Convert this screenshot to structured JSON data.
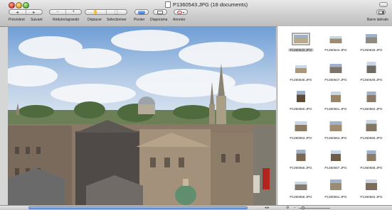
{
  "window": {
    "title": "P1360543.JPG (18 documents)"
  },
  "toolbar": {
    "prev_next": {
      "prev": "Précédent",
      "next": "Suivant"
    },
    "zoom": {
      "label": "Réduire/agrandir",
      "minus": "−",
      "plus": "+"
    },
    "move": {
      "label": "Déplacer"
    },
    "select": {
      "label": "Sélectionner"
    },
    "rotate": {
      "label": "Pivoter"
    },
    "slideshow": {
      "label": "Diaporama"
    },
    "annotate": {
      "label": "Annoter"
    },
    "sidebar": {
      "label": "Barre latérale"
    }
  },
  "thumbnails": [
    {
      "name": "P1360543.JPG",
      "selected": true
    },
    {
      "name": "P1360544.JPG",
      "selected": false
    },
    {
      "name": "P1360545.JPG",
      "selected": false
    },
    {
      "name": "P1360546.JPG",
      "selected": false
    },
    {
      "name": "P1360547.JPG",
      "selected": false
    },
    {
      "name": "P1360549.JPG",
      "selected": false
    },
    {
      "name": "P1360550.JPG",
      "selected": false
    },
    {
      "name": "P1360551.JPG",
      "selected": false
    },
    {
      "name": "P1360552.JPG",
      "selected": false
    },
    {
      "name": "P1360553.JPG",
      "selected": false
    },
    {
      "name": "P1360554.JPG",
      "selected": false
    },
    {
      "name": "P1360555.JPG",
      "selected": false
    },
    {
      "name": "P1360556.JPG",
      "selected": false
    },
    {
      "name": "P1360557.JPG",
      "selected": false
    },
    {
      "name": "P1360558.JPG",
      "selected": false
    },
    {
      "name": "P1360559.JPG",
      "selected": false
    },
    {
      "name": "P1360561.JPG",
      "selected": false
    },
    {
      "name": "P1360562.JPG",
      "selected": false
    }
  ],
  "bottom_bar": {
    "arrows": "◂ ▸",
    "settings_icon": "⚙",
    "zoom_icon": "−"
  },
  "colors": {
    "accent": "#2d6fd6",
    "annotate": "#d43b3b"
  }
}
